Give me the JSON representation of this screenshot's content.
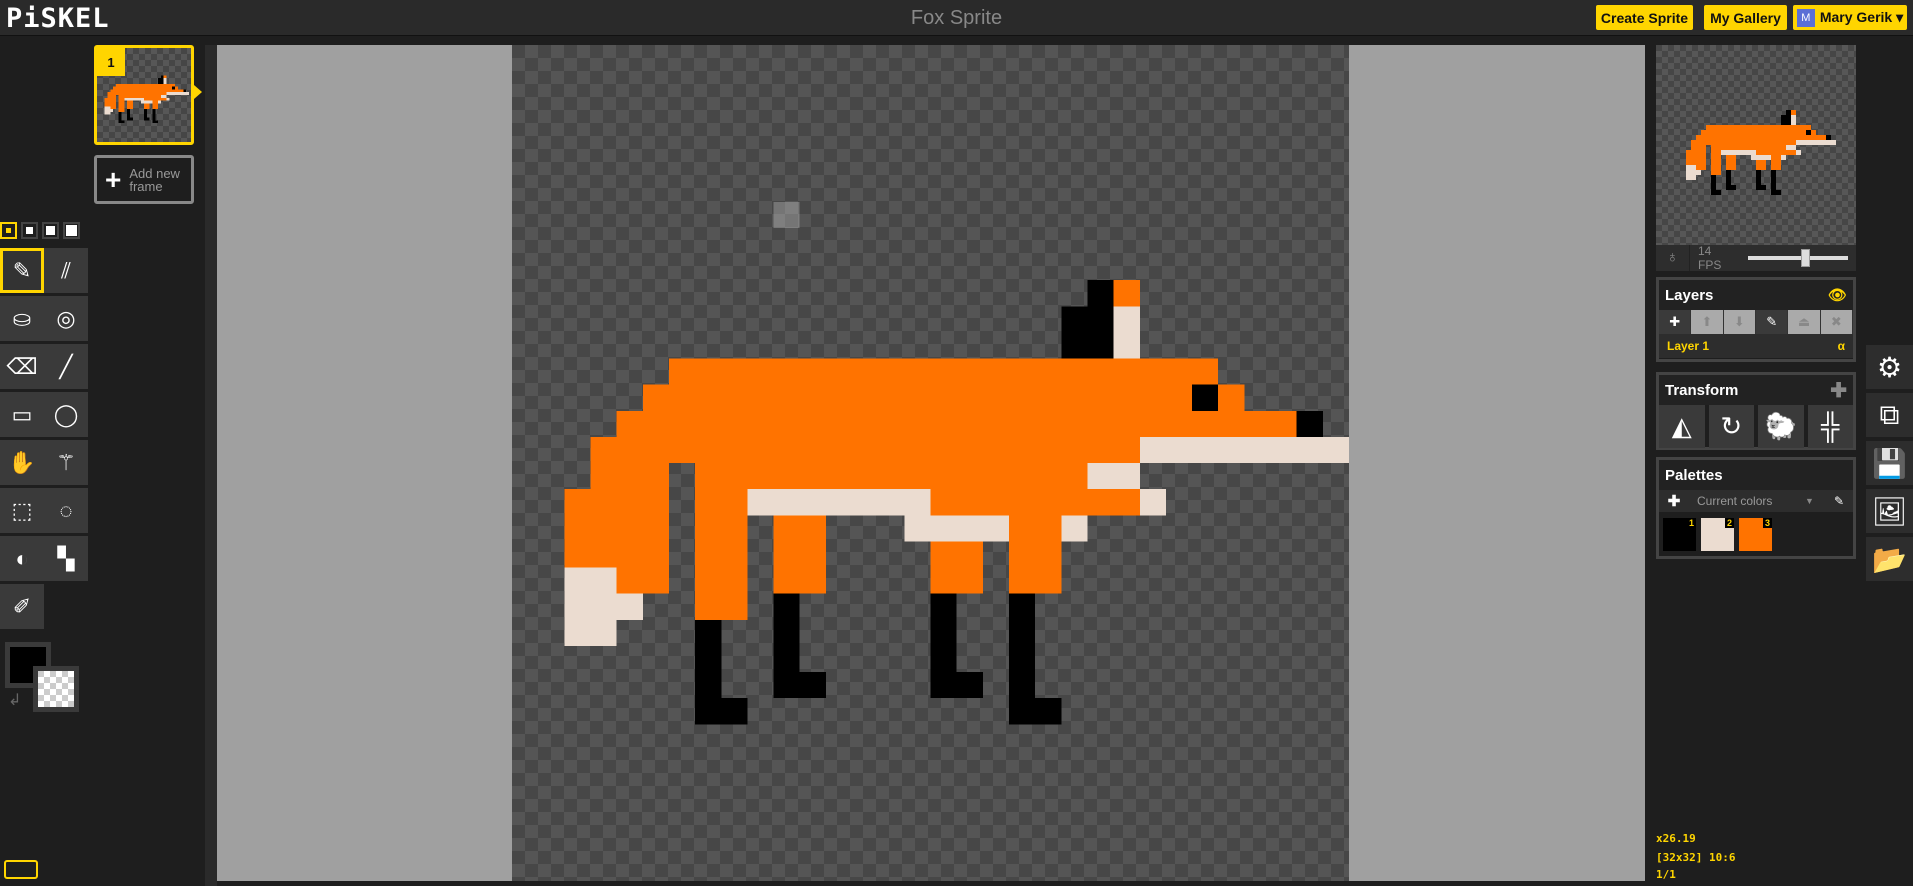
{
  "app": {
    "logo": "PiSKEL",
    "title": "Fox Sprite"
  },
  "header": {
    "create_label": "Create Sprite",
    "gallery_label": "My Gallery",
    "user_initial": "M",
    "user_name": "Mary Gerik ▾"
  },
  "frames": {
    "items": [
      {
        "number": "1"
      }
    ],
    "add_label": "Add new frame"
  },
  "tools": {
    "pen_sizes": [
      1,
      2,
      3,
      4
    ],
    "selected_pen_size": 1,
    "items": [
      {
        "name": "pen",
        "glyph": "✎",
        "selected": true
      },
      {
        "name": "vertical-mirror-pen",
        "glyph": "⫽"
      },
      {
        "name": "paint-bucket",
        "glyph": "⛀"
      },
      {
        "name": "paint-all-same-color",
        "glyph": "◎"
      },
      {
        "name": "eraser",
        "glyph": "⌫"
      },
      {
        "name": "stroke",
        "glyph": "╱"
      },
      {
        "name": "rectangle",
        "glyph": "▭"
      },
      {
        "name": "circle",
        "glyph": "◯"
      },
      {
        "name": "move",
        "glyph": "✋"
      },
      {
        "name": "magic-wand",
        "glyph": "⚚"
      },
      {
        "name": "rectangle-select",
        "glyph": "⬚"
      },
      {
        "name": "lasso-select",
        "glyph": "◌"
      },
      {
        "name": "lighten",
        "glyph": "◐"
      },
      {
        "name": "dithering",
        "glyph": "▚"
      },
      {
        "name": "color-picker",
        "glyph": "✐"
      }
    ],
    "primary_color": "#000000",
    "secondary_color": "transparent"
  },
  "sprite": {
    "width": 32,
    "height": 32,
    "colors": {
      "o": "#ff7300",
      "c": "#ebdcd0",
      "k": "#000000"
    },
    "hover_cell": [
      10,
      6
    ],
    "rows": {
      "9": "......................ko........",
      "10": ".....................kkc........",
      "11": ".....................kkc........",
      "12": "......ooooooooooooooooooooo.....",
      "13": ".....oooooooooooooooooooooko.....",
      "14": "....ooooooooooooooooooooooooook.",
      "15": "...ooooooooooooooooooooocccccccc",
      "16": "...ooo.ooooooooooooooocc........",
      "17": "..oooo.oocccccccooooooooc.........",
      "18": "..oooo.oo.oo...ccccooc..........",
      "19": "..oooo.oo.oo....oo.oo...........",
      "20": "..ccoo.oo.oo....oo.oo...........",
      "21": "..ccc..oo.k.....k..k............",
      "22": "..cc...k..k.....k..k............",
      "23": ".......k..k.....k..k............",
      "24": ".......k..kk....kk.k............",
      "25": ".......kk..........kk..........."
    }
  },
  "preview": {
    "fps_label": "14 FPS",
    "fps": 14,
    "fps_max": 24
  },
  "layers": {
    "title": "Layers",
    "items": [
      {
        "name": "Layer 1",
        "alpha_label": "α"
      }
    ]
  },
  "transform": {
    "title": "Transform",
    "tools": [
      "flip",
      "rotate",
      "clone",
      "center"
    ]
  },
  "palettes": {
    "title": "Palettes",
    "selected": "Current colors",
    "swatches": [
      {
        "n": "1",
        "color": "#000000"
      },
      {
        "n": "2",
        "color": "#ebdcd0"
      },
      {
        "n": "3",
        "color": "#ff7300"
      }
    ]
  },
  "side_tools": [
    "settings",
    "resize",
    "save",
    "export",
    "import"
  ],
  "status": {
    "zoom": "x26.19",
    "info": "[32x32] 10:6",
    "frame": "1/1"
  },
  "accent": "#ffd500"
}
